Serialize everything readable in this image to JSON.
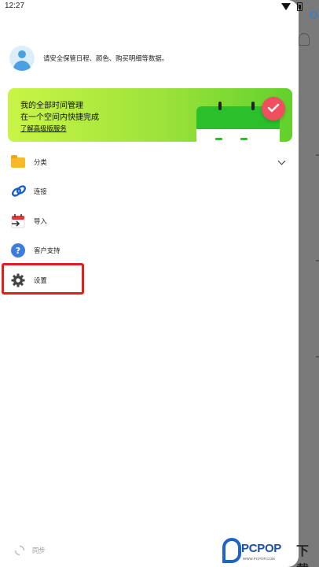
{
  "status_bar": {
    "time": "12:27"
  },
  "profile": {
    "message": "请安全保管日程、颜色、购买明细等数据。"
  },
  "promo": {
    "line1": "我的全部时间管理",
    "line2": "在一个空间内快捷完成",
    "link": "了解高级版服务"
  },
  "menu": {
    "items": [
      {
        "label": "分类",
        "icon": "folder-icon"
      },
      {
        "label": "连接",
        "icon": "link-icon"
      },
      {
        "label": "导入",
        "icon": "calendar-import-icon"
      },
      {
        "label": "客户支持",
        "icon": "help-icon"
      },
      {
        "label": "设置",
        "icon": "gear-icon"
      }
    ]
  },
  "sync": {
    "label": "同步"
  },
  "watermark": {
    "brand": "PCPOP",
    "brand2": "下载",
    "sub": "WWW.PCPOP.COM"
  },
  "colors": {
    "accent_red": "#ef4f5f",
    "promo_green": "#9be23a",
    "highlight": "#e0201c"
  }
}
